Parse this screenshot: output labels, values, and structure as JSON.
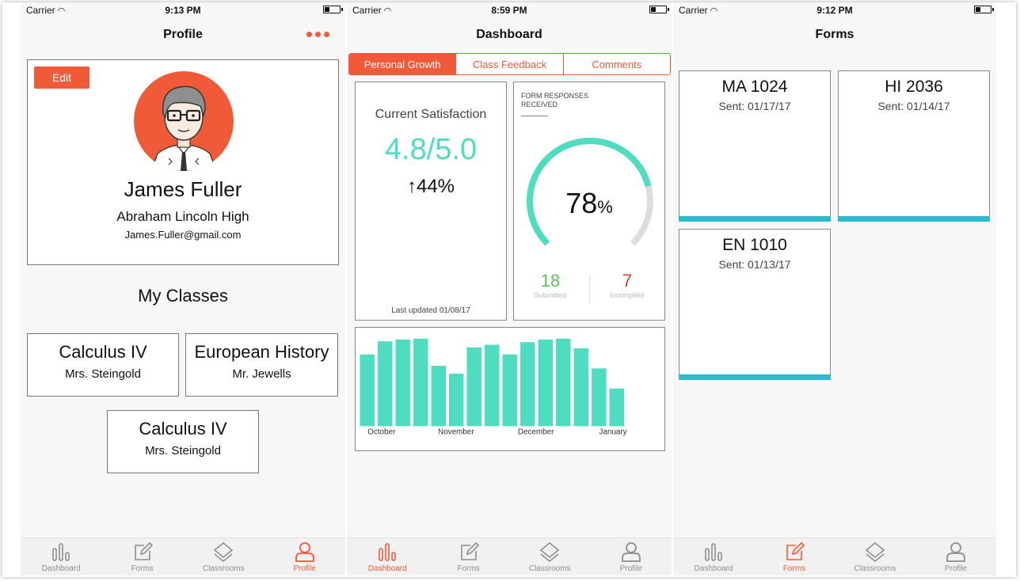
{
  "theme": {
    "accent": "#f05a38",
    "teal": "#4fdcc0",
    "form_bar": "#2bbcd0",
    "green": "#59c359",
    "red": "#d63b2f"
  },
  "tab_labels": {
    "dashboard": "Dashboard",
    "forms": "Forms",
    "classrooms": "Classrooms",
    "profile": "Profile"
  },
  "screens": [
    {
      "status": {
        "carrier": "Carrier",
        "time": "9:13 PM"
      },
      "nav_title": "Profile",
      "profile": {
        "edit_label": "Edit",
        "name": "James Fuller",
        "school": "Abraham Lincoln High",
        "email": "James.Fuller@gmail.com"
      },
      "my_classes_title": "My Classes",
      "classes": [
        {
          "name": "Calculus IV",
          "teacher": "Mrs. Steingold"
        },
        {
          "name": "European History",
          "teacher": "Mr. Jewells"
        },
        {
          "name": "Calculus IV",
          "teacher": "Mrs. Steingold"
        }
      ],
      "active_tab": "profile"
    },
    {
      "status": {
        "carrier": "Carrier",
        "time": "8:59 PM"
      },
      "nav_title": "Dashboard",
      "segments": [
        "Personal Growth",
        "Class Feedback",
        "Comments"
      ],
      "active_segment": "Personal Growth",
      "satisfaction": {
        "title": "Current Satisfaction",
        "value": "4.8/5.0",
        "change": "44%",
        "updated": "Last updated 01/08/17"
      },
      "responses": {
        "label": "FORM RESPONSES RECEIVED",
        "percent": "78",
        "percent_sign": "%",
        "fraction": 0.78,
        "submitted_count": "18",
        "submitted_label": "Submitted",
        "incomplete_count": "7",
        "incomplete_label": "Incomplete"
      },
      "chart_data": {
        "type": "bar",
        "categories": [
          "October",
          "",
          "",
          "",
          "November",
          "",
          "",
          "",
          "December",
          "",
          "",
          "",
          "January"
        ],
        "x_tick_labels": [
          "October",
          "November",
          "December",
          "January"
        ],
        "values": [
          0.82,
          0.97,
          0.99,
          1.0,
          0.69,
          0.6,
          0.9,
          0.93,
          0.82,
          0.96,
          0.99,
          1.0,
          0.89,
          0.66,
          0.43
        ],
        "ylim": [
          0,
          1
        ],
        "color": "#4fdcc0",
        "grid": false,
        "legend": "none"
      },
      "active_tab": "dashboard"
    },
    {
      "status": {
        "carrier": "Carrier",
        "time": "9:12 PM"
      },
      "nav_title": "Forms",
      "forms": [
        {
          "code": "MA 1024",
          "sent": "Sent: 01/17/17"
        },
        {
          "code": "HI 2036",
          "sent": "Sent: 01/14/17"
        },
        {
          "code": "EN 1010",
          "sent": "Sent: 01/13/17"
        }
      ],
      "active_tab": "forms"
    }
  ]
}
